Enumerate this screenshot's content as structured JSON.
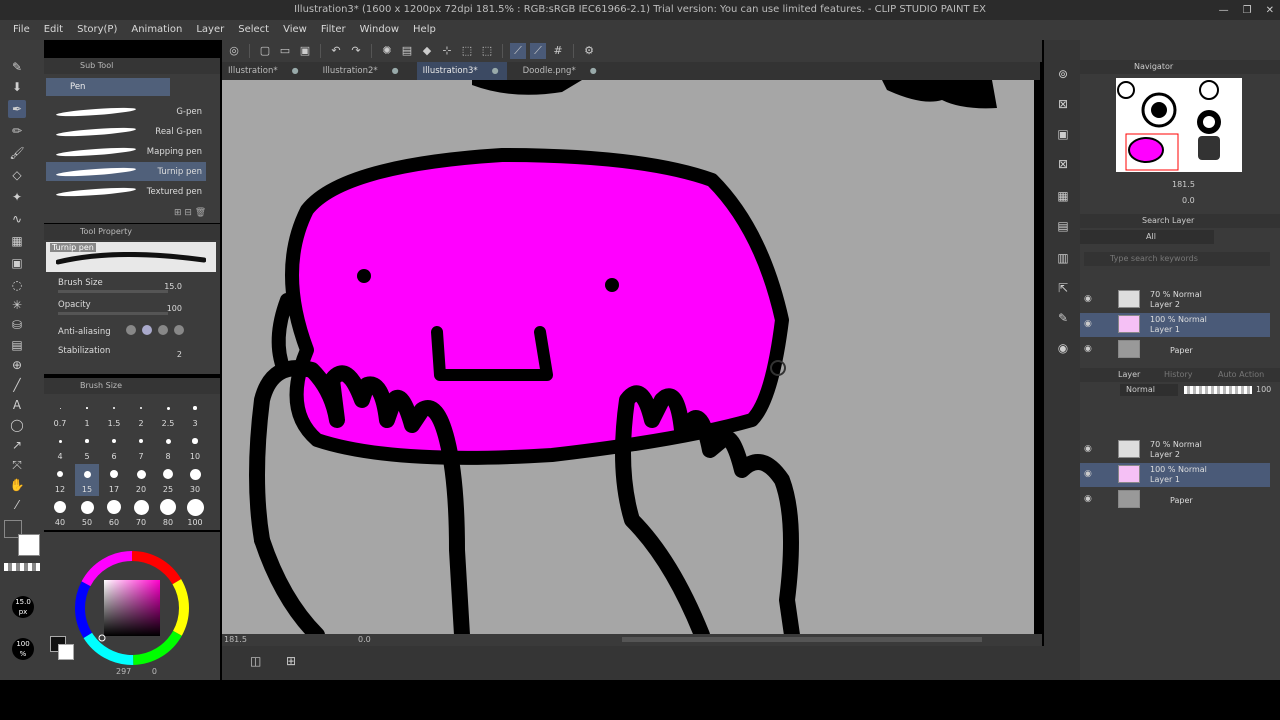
{
  "window": {
    "title": "Illustration3* (1600 x 1200px 72dpi 181.5% : RGB:sRGB IEC61966-2.1)  Trial version: You can use limited features. - CLIP STUDIO PAINT EX",
    "controls": [
      "—",
      "❐",
      "✕"
    ]
  },
  "menu": [
    "File",
    "Edit",
    "Story(P)",
    "Animation",
    "Layer",
    "Select",
    "View",
    "Filter",
    "Window",
    "Help"
  ],
  "subtool": {
    "panel_title": "Sub Tool",
    "group": "Pen",
    "brushes": [
      {
        "label": "G-pen",
        "selected": false
      },
      {
        "label": "Real G-pen",
        "selected": false
      },
      {
        "label": "Mapping pen",
        "selected": false
      },
      {
        "label": "Turnip pen",
        "selected": true
      },
      {
        "label": "Textured pen",
        "selected": false
      }
    ]
  },
  "tool_property": {
    "panel_title": "Tool Property",
    "preview_name": "Turnip pen",
    "brush_size_label": "Brush Size",
    "brush_size_value": "15.0",
    "opacity_label": "Opacity",
    "opacity_value": "100",
    "antialiasing_label": "Anti-aliasing",
    "stabilization_label": "Stabilization",
    "stabilization_value": "2"
  },
  "brush_size": {
    "panel_title": "Brush Size",
    "sizes": [
      "0.7",
      "1",
      "1.5",
      "2",
      "2.5",
      "3",
      "4",
      "5",
      "6",
      "7",
      "8",
      "10",
      "12",
      "15",
      "17",
      "20",
      "25",
      "30",
      "40",
      "50",
      "60",
      "70",
      "80",
      "100"
    ]
  },
  "color": {
    "main": "#111111",
    "sub": "#ffffff",
    "size_readout": "15.0",
    "size_unit": "px",
    "opacity_readout": "100",
    "opacity_unit": "%",
    "bottom_readout": "297",
    "bottom_readout2": "0"
  },
  "tabs": [
    {
      "label": "Illustration*",
      "active": false
    },
    {
      "label": "Illustration2*",
      "active": false
    },
    {
      "label": "Illustration3*",
      "active": true
    },
    {
      "label": "Doodle.png*",
      "active": false
    }
  ],
  "canvas": {
    "blob_color": "#ff00ff",
    "bg_color": "#a6a6a6",
    "zoom_readout": "181.5",
    "angle_readout": "0.0"
  },
  "navigator": {
    "title": "Navigator",
    "zoom": "181.5",
    "angle": "0.0"
  },
  "search_layer": {
    "title": "Search Layer",
    "filter": "All",
    "placeholder": "Type search keywords"
  },
  "layers_top": [
    {
      "blend": "70 % Normal",
      "name": "Layer 2",
      "selected": false
    },
    {
      "blend": "100 % Normal",
      "name": "Layer 1",
      "selected": true
    },
    {
      "blend": "",
      "name": "Paper",
      "selected": false
    }
  ],
  "layer_panel": {
    "tab_layer": "Layer",
    "tab_history": "History",
    "tab_auto": "Auto Action",
    "blend_mode": "Normal",
    "opacity": "100"
  },
  "layers_bottom": [
    {
      "blend": "70 % Normal",
      "name": "Layer 2",
      "selected": false
    },
    {
      "blend": "100 % Normal",
      "name": "Layer 1",
      "selected": true
    },
    {
      "blend": "",
      "name": "Paper",
      "selected": false
    }
  ]
}
